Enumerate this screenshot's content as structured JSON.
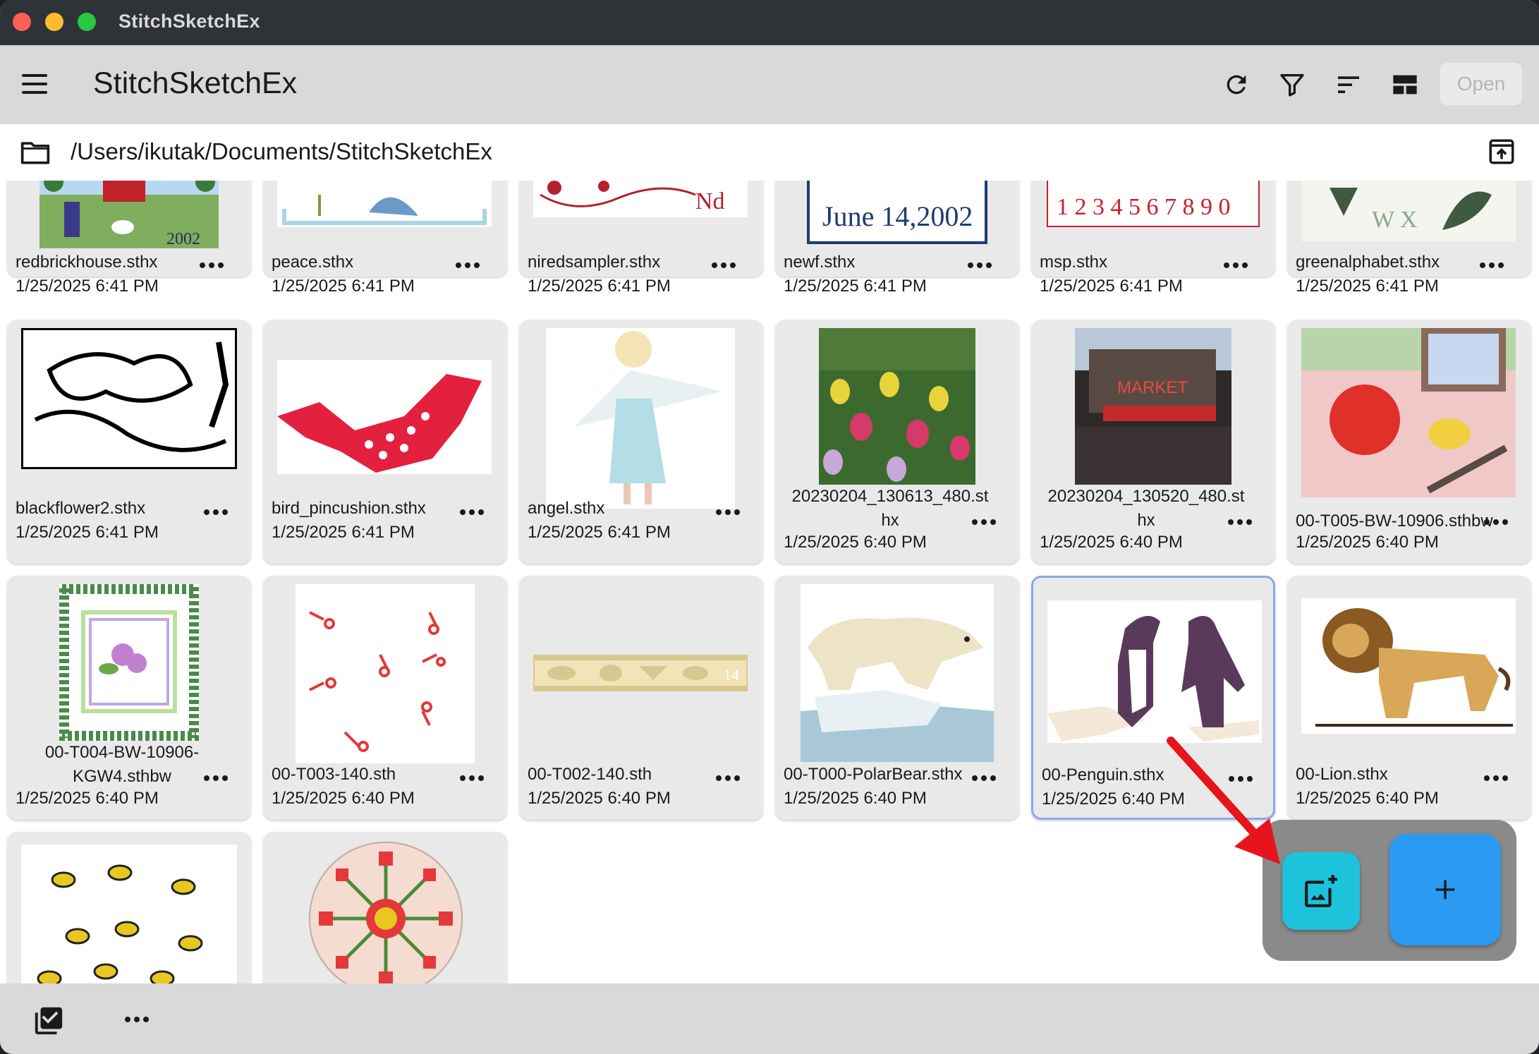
{
  "window": {
    "title": "StitchSketchEx"
  },
  "appbar": {
    "title": "StitchSketchEx",
    "open_label": "Open"
  },
  "path": {
    "text": "/Users/ikutak/Documents/StitchSketchEx"
  },
  "files": [
    {
      "name": "redbrickhouse.sthx",
      "date": "1/25/2025 6:41 PM"
    },
    {
      "name": "peace.sthx",
      "date": "1/25/2025 6:41 PM"
    },
    {
      "name": "niredsampler.sthx",
      "date": "1/25/2025 6:41 PM"
    },
    {
      "name": "newf.sthx",
      "date": "1/25/2025 6:41 PM"
    },
    {
      "name": "msp.sthx",
      "date": "1/25/2025 6:41 PM"
    },
    {
      "name": "greenalphabet.sthx",
      "date": "1/25/2025 6:41 PM"
    },
    {
      "name": "blackflower2.sthx",
      "date": "1/25/2025 6:41 PM"
    },
    {
      "name": "bird_pincushion.sthx",
      "date": "1/25/2025 6:41 PM"
    },
    {
      "name": "angel.sthx",
      "date": "1/25/2025 6:41 PM"
    },
    {
      "name": "20230204_130613_480.sthx",
      "name_line1": "20230204_130613_480.st",
      "name_line2": "hx",
      "date": "1/25/2025 6:40 PM"
    },
    {
      "name": "20230204_130520_480.sthx",
      "name_line1": "20230204_130520_480.st",
      "name_line2": "hx",
      "date": "1/25/2025 6:40 PM"
    },
    {
      "name": "00-T005-BW-10906.sthbw",
      "date": "1/25/2025 6:40 PM"
    },
    {
      "name": "00-T004-BW-10906-KGW4.sthbw",
      "name_line1": "00-T004-BW-10906-",
      "name_line2": "KGW4.sthbw",
      "date": "1/25/2025 6:40 PM"
    },
    {
      "name": "00-T003-140.sth",
      "date": "1/25/2025 6:40 PM"
    },
    {
      "name": "00-T002-140.sth",
      "date": "1/25/2025 6:40 PM"
    },
    {
      "name": "00-T000-PolarBear.sthx",
      "date": "1/25/2025 6:40 PM"
    },
    {
      "name": "00-Penguin.sthx",
      "date": "1/25/2025 6:40 PM"
    },
    {
      "name": "00-Lion.sthx",
      "date": "1/25/2025 6:40 PM"
    }
  ],
  "icons": {
    "menu": "hamburger-menu-icon",
    "refresh": "refresh-icon",
    "filter": "filter-icon",
    "sort": "sort-icon",
    "layout": "grid-layout-icon",
    "folder": "folder-icon",
    "upload": "open-in-parent-icon",
    "add_image": "add-photo-icon",
    "add": "plus-icon",
    "select": "select-checkbox-icon"
  },
  "colors": {
    "accent_teal": "#1cc3db",
    "accent_blue": "#2a9af3",
    "selected_border": "#8aa8f0",
    "annotation_arrow": "#e8141c"
  }
}
